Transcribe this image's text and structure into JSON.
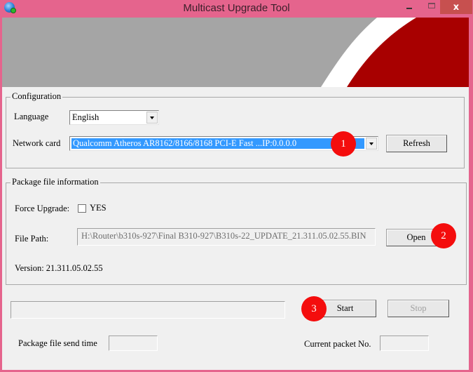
{
  "window": {
    "title": "Multicast Upgrade Tool",
    "icon": "globe-network-icon",
    "controls": {
      "minimize": "minimize",
      "maximize": "maximize",
      "close": "x"
    },
    "colors": {
      "frame": "#e5648d",
      "close": "#c7504f",
      "banner_gray": "#a5a5a5",
      "banner_red": "#a80000"
    }
  },
  "configuration": {
    "legend": "Configuration",
    "language_label": "Language",
    "language_value": "English",
    "network_card_label": "Network card",
    "network_card_value": "Qualcomm Atheros AR8162/8166/8168 PCI-E Fast ...IP:0.0.0.0",
    "refresh_label": "Refresh"
  },
  "package": {
    "legend": "Package file information",
    "force_upgrade_label": "Force Upgrade:",
    "force_upgrade_option": "YES",
    "force_upgrade_checked": false,
    "file_path_label": "File Path:",
    "file_path_value": "H:\\Router\\b310s-927\\Final B310-927\\B310s-22_UPDATE_21.311.05.02.55.BIN",
    "open_label": "Open",
    "version_text": "Version: 21.311.05.02.55"
  },
  "transfer": {
    "progress": 0,
    "start_label": "Start",
    "stop_label": "Stop",
    "send_time_label": "Package file send time",
    "send_time_value": "",
    "packet_label": "Current packet No.",
    "packet_value": ""
  },
  "annotations": [
    {
      "number": "1",
      "color": "#f40d0d"
    },
    {
      "number": "2",
      "color": "#f40d0d"
    },
    {
      "number": "3",
      "color": "#f40d0d"
    }
  ]
}
